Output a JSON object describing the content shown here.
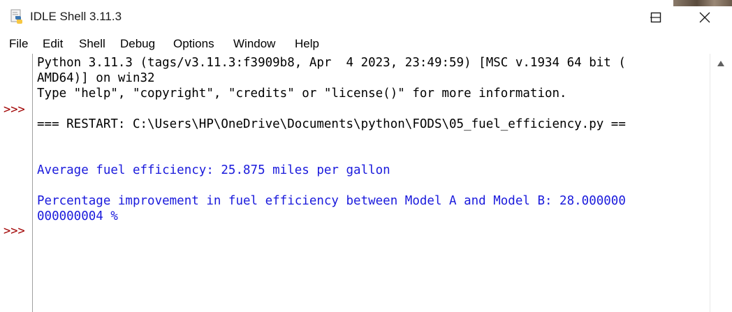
{
  "window": {
    "title": "IDLE Shell 3.11.3",
    "icon": "python-idle-icon",
    "buttons": [
      "minimize-icon",
      "maximize-icon",
      "close-icon"
    ]
  },
  "menu": {
    "items": [
      "File",
      "Edit",
      "Shell",
      "Debug",
      "Options",
      "Window",
      "Help"
    ]
  },
  "shell": {
    "prompts": [
      ">>>",
      ">>>"
    ],
    "lines": [
      {
        "text": "Python 3.11.3 (tags/v3.11.3:f3909b8, Apr  4 2023, 23:49:59) [MSC v.1934 64 bit (",
        "style": "stdout"
      },
      {
        "text": "AMD64)] on win32",
        "style": "stdout"
      },
      {
        "text": "Type \"help\", \"copyright\", \"credits\" or \"license()\" for more information.",
        "style": "stdout"
      },
      {
        "text": "=== RESTART: C:\\Users\\HP\\OneDrive\\Documents\\python\\FODS\\05_fuel_efficiency.py ==",
        "style": "stdout"
      },
      {
        "text": "Average fuel efficiency: 25.875 miles per gallon",
        "style": "output"
      },
      {
        "text": "Percentage improvement in fuel efficiency between Model A and Model B: 28.000000",
        "style": "output"
      },
      {
        "text": "000000004 %",
        "style": "output"
      }
    ]
  },
  "colors": {
    "prompt": "#a00000",
    "output": "#1a1adc",
    "stdout": "#000000"
  }
}
